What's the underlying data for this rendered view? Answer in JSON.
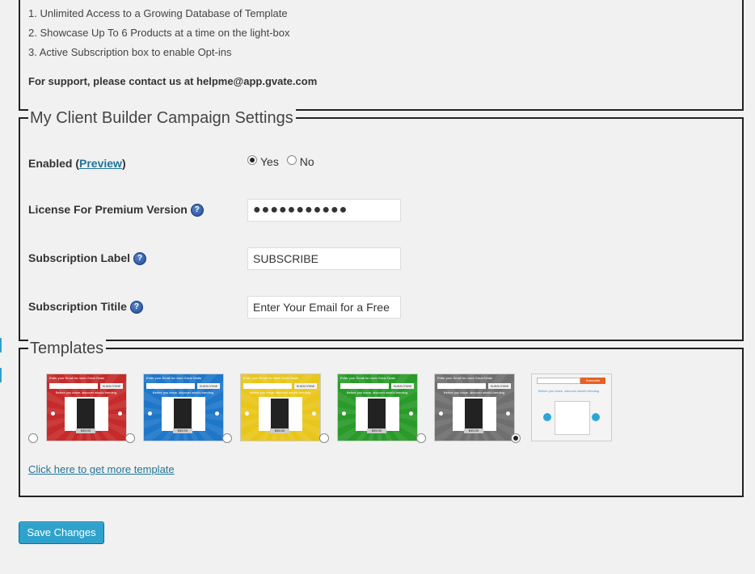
{
  "features": {
    "items": [
      "1. Unlimited Access to a Growing Database of Template",
      "2. Showcase Up To 6 Products at a time on the light-box",
      "3. Active Subscription box to enable Opt-ins"
    ],
    "support": "For support, please contact us at helpme@app.gvate.com"
  },
  "settings": {
    "legend": "My Client Builder Campaign Settings",
    "enabled_label": "Enabled (",
    "preview_link": "Preview",
    "enabled_close": ")",
    "yes_label": "Yes",
    "no_label": "No",
    "enabled_value": "Yes",
    "license_label": "License For Premium Version",
    "license_value": "●●●●●●●●●●●",
    "subscription_label": "Subscription Label",
    "subscription_label_value": "SUBSCRIBE",
    "subscription_title": "Subscription Titile",
    "subscription_title_value": "Enter Your Email for a Free"
  },
  "templates": {
    "legend": "Templates",
    "selected_index": 5,
    "thumb_text": {
      "header": "Enter your Email for more Great Deals",
      "button": "SUBSCRIBE",
      "tagline": "Before you leave, discover what's trending.",
      "price": "$45.00",
      "button6": "Subscribe",
      "tagline6": "Before you leave, discover what's trending"
    },
    "colors": [
      "#c62a2a",
      "#1f77c9",
      "#e9c61b",
      "#2a9a2a",
      "#6f6f6f"
    ],
    "more_link": "Click here to get more template"
  },
  "save_button": "Save Changes",
  "help_icon": "question-mark-icon"
}
